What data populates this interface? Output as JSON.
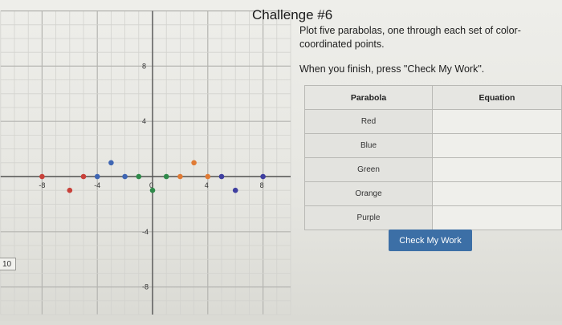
{
  "page": {
    "title": "Challenge #6",
    "instruction_1": "Plot five parabolas, one through each set of color-coordinated points.",
    "instruction_2": "When you finish, press \"Check My Work\".",
    "side_label": "10"
  },
  "table": {
    "header_parabola": "Parabola",
    "header_equation": "Equation",
    "rows": [
      {
        "name": "Red",
        "equation": ""
      },
      {
        "name": "Blue",
        "equation": ""
      },
      {
        "name": "Green",
        "equation": ""
      },
      {
        "name": "Orange",
        "equation": ""
      },
      {
        "name": "Purple",
        "equation": ""
      }
    ]
  },
  "check_button": "Check My Work",
  "graph": {
    "x_ticks": [
      "-8",
      "-4",
      "0",
      "4",
      "8"
    ],
    "y_ticks": [
      "8",
      "4",
      "-4",
      "-8"
    ],
    "colors": {
      "red": "#c8413a",
      "blue": "#3f66b3",
      "green": "#2f8a4a",
      "orange": "#e07b35",
      "purple": "#3f3fa0"
    },
    "points": {
      "red": [
        [
          -8,
          0
        ],
        [
          -6,
          -1
        ],
        [
          -5,
          0
        ]
      ],
      "blue": [
        [
          -4,
          0
        ],
        [
          -3,
          1
        ],
        [
          -2,
          0
        ]
      ],
      "green": [
        [
          -1,
          0
        ],
        [
          0,
          -1
        ],
        [
          1,
          0
        ]
      ],
      "orange": [
        [
          2,
          0
        ],
        [
          3,
          1
        ],
        [
          4,
          0
        ]
      ],
      "purple": [
        [
          5,
          0
        ],
        [
          6,
          -1
        ],
        [
          8,
          0
        ]
      ]
    }
  }
}
